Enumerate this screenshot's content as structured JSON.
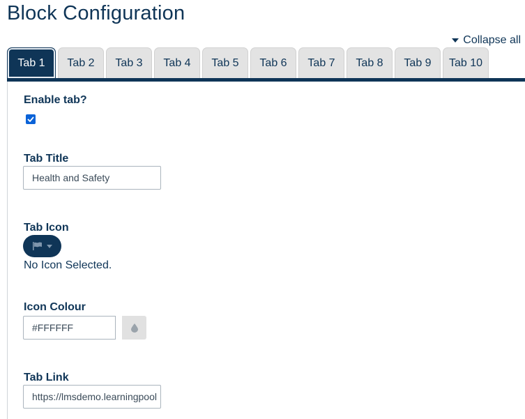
{
  "page": {
    "title": "Block Configuration",
    "collapse_all": "Collapse all"
  },
  "tabs": [
    {
      "label": "Tab 1",
      "active": true
    },
    {
      "label": "Tab 2"
    },
    {
      "label": "Tab 3"
    },
    {
      "label": "Tab 4"
    },
    {
      "label": "Tab 5"
    },
    {
      "label": "Tab 6"
    },
    {
      "label": "Tab 7"
    },
    {
      "label": "Tab 8"
    },
    {
      "label": "Tab 9"
    },
    {
      "label": "Tab 10"
    }
  ],
  "form": {
    "enable_tab": {
      "label": "Enable tab?",
      "checked": true
    },
    "tab_title": {
      "label": "Tab Title",
      "value": "Health and Safety"
    },
    "tab_icon": {
      "label": "Tab Icon",
      "icon": "flag-icon",
      "status": "No Icon Selected."
    },
    "icon_colour": {
      "label": "Icon Colour",
      "value": "#FFFFFF",
      "button_icon": "droplet-icon"
    },
    "tab_link": {
      "label": "Tab Link",
      "value": "https://lmsdemo.learningpool"
    }
  },
  "colors": {
    "primary": "#0f3557",
    "tab_inactive": "#e3e3e3",
    "checkbox": "#0b63d8"
  }
}
